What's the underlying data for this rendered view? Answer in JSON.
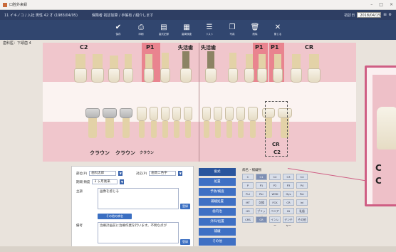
{
  "window": {
    "title": "口腔外来録",
    "controls": [
      "–",
      "□",
      "×"
    ]
  },
  "infobar": {
    "patient": "11 イキノコ / 入社 男性 42 才 (1983/04/05)",
    "note": "保険者 初診加算 / 手帳有 / 紹介します",
    "date_label": "初診日",
    "date_value": "2018/04/15",
    "icons": [
      "⊞",
      "⚙"
    ]
  },
  "toolbar": {
    "buttons": [
      {
        "icon": "check-icon",
        "glyph": "✔",
        "label": "保存"
      },
      {
        "icon": "print-icon",
        "glyph": "⎙",
        "label": "印刷"
      },
      {
        "icon": "document-icon",
        "glyph": "▤",
        "label": "歯式記録"
      },
      {
        "icon": "chart-icon",
        "glyph": "▦",
        "label": "歯周検査"
      },
      {
        "icon": "list-icon",
        "glyph": "☰",
        "label": "リスト"
      },
      {
        "icon": "copy-icon",
        "glyph": "❐",
        "label": "写真"
      },
      {
        "icon": "trash-icon",
        "glyph": "🗑",
        "label": "削除"
      },
      {
        "icon": "close-icon",
        "glyph": "✕",
        "label": "閉じる"
      }
    ]
  },
  "subinfo": "歯科医：下頜歯 4",
  "chart": {
    "upper_labels": [
      "C2",
      "P1",
      "失活歯",
      "失活歯",
      "P1",
      "P1",
      "CR"
    ],
    "lower_labels": {
      "crown1": "クラウン",
      "crown2": "クラウン",
      "crown3": "クラウン",
      "cr": "CR",
      "c2": "C2"
    }
  },
  "zoom": {
    "letters": [
      "C",
      "C"
    ]
  },
  "form": {
    "tooth_label": "部位(P)",
    "tooth_value": "歯科太郎",
    "disease_label": "対応(P)",
    "disease_value": "歯周ニ色字",
    "period_label": "期間 頻度",
    "period_value": "3 ヶ月後来",
    "main_label": "主訴",
    "main_text": "画像を感じる",
    "main_btn": "登録",
    "history_btn": "その他の病名",
    "note_label": "備考",
    "note_text": "治療計画前に治療作業を行います。不明な点が",
    "note_btn": "登録"
  },
  "categories": [
    {
      "label": "歯式",
      "active": true
    },
    {
      "label": "処置",
      "active": false
    },
    {
      "label": "予防/検査",
      "active": false
    },
    {
      "label": "補綴処置",
      "active": false
    },
    {
      "label": "歯内治",
      "active": false
    },
    {
      "label": "外科/処置",
      "active": false
    },
    {
      "label": "補綴",
      "active": false
    },
    {
      "label": "その他",
      "active": false
    }
  ],
  "grid": {
    "title": "病名・補綴物",
    "cells": [
      {
        "label": "C",
        "sel": false
      },
      {
        "label": "C1",
        "sel": true
      },
      {
        "label": "C2",
        "sel": false
      },
      {
        "label": "C3",
        "sel": false
      },
      {
        "label": "C4",
        "sel": false
      },
      {
        "label": "P",
        "sel": false
      },
      {
        "label": "P1",
        "sel": false
      },
      {
        "label": "P2",
        "sel": false
      },
      {
        "label": "P3",
        "sel": false
      },
      {
        "label": "P4",
        "sel": false
      },
      {
        "label": "Pul",
        "sel": false
      },
      {
        "label": "Per",
        "sel": false
      },
      {
        "label": "WSD",
        "sel": false
      },
      {
        "label": "Hys",
        "sel": false
      },
      {
        "label": "Per",
        "sel": false
      },
      {
        "label": "MT",
        "sel": false
      },
      {
        "label": "欠損",
        "sel": false
      },
      {
        "label": "FCK",
        "sel": false
      },
      {
        "label": "CR",
        "sel": false
      },
      {
        "label": "Inl",
        "sel": false
      },
      {
        "label": "HS",
        "sel": false
      },
      {
        "label": "ブリッジ",
        "sel": false
      },
      {
        "label": "ベニア",
        "sel": false
      },
      {
        "label": "IN",
        "sel": false
      },
      {
        "label": "乳歯",
        "sel": false
      },
      {
        "label": "CRS",
        "sel": false
      },
      {
        "label": "CR",
        "sel": true
      },
      {
        "label": "インレー",
        "sel": false
      },
      {
        "label": "デンチャー",
        "sel": false
      },
      {
        "label": "その他",
        "sel": false
      }
    ]
  }
}
